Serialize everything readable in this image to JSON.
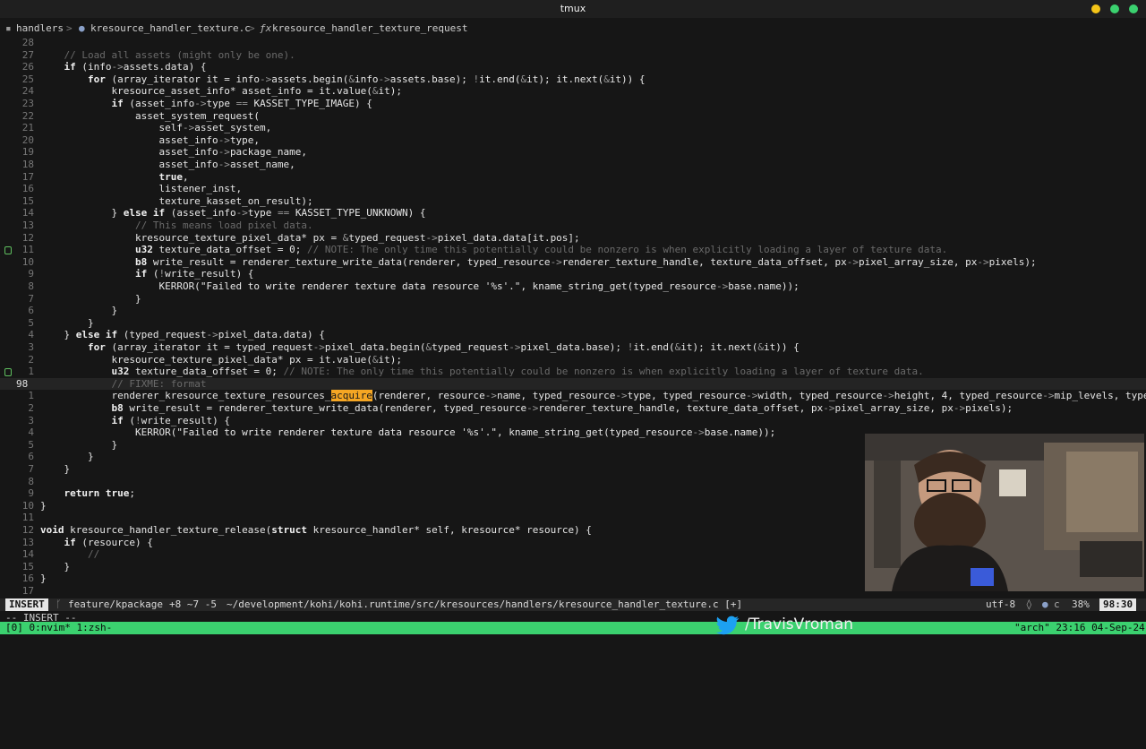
{
  "titlebar": {
    "title": "tmux",
    "buttons": [
      "#f5c518",
      "#3bd16f",
      "#3bd16f"
    ]
  },
  "winbar": {
    "seg1": "handlers",
    "sep1": ">",
    "seg2": "kresource_handler_texture.c",
    "sep2": ">",
    "seg3": "kresource_handler_texture_request"
  },
  "editor": {
    "lines": [
      {
        "ln": "28",
        "t": ""
      },
      {
        "ln": "27",
        "t": "    // Load all assets (might only be one)."
      },
      {
        "ln": "26",
        "t": "    if (info->assets.data) {"
      },
      {
        "ln": "25",
        "t": "        for (array_iterator it = info->assets.begin(&info->assets.base); !it.end(&it); it.next(&it)) {"
      },
      {
        "ln": "24",
        "t": "            kresource_asset_info* asset_info = it.value(&it);"
      },
      {
        "ln": "23",
        "t": "            if (asset_info->type == KASSET_TYPE_IMAGE) {"
      },
      {
        "ln": "22",
        "t": "                asset_system_request("
      },
      {
        "ln": "21",
        "t": "                    self->asset_system,"
      },
      {
        "ln": "20",
        "t": "                    asset_info->type,"
      },
      {
        "ln": "19",
        "t": "                    asset_info->package_name,"
      },
      {
        "ln": "18",
        "t": "                    asset_info->asset_name,"
      },
      {
        "ln": "17",
        "t": "                    true,"
      },
      {
        "ln": "16",
        "t": "                    listener_inst,"
      },
      {
        "ln": "15",
        "t": "                    texture_kasset_on_result);"
      },
      {
        "ln": "14",
        "t": "            } else if (asset_info->type == KASSET_TYPE_UNKNOWN) {"
      },
      {
        "ln": "13",
        "t": "                // This means load pixel data."
      },
      {
        "ln": "12",
        "t": "                kresource_texture_pixel_data* px = &typed_request->pixel_data.data[it.pos];"
      },
      {
        "ln": "11",
        "t": "                u32 texture_data_offset = 0; // NOTE: The only time this potentially could be nonzero is when explicitly loading a layer of texture data.",
        "g": true
      },
      {
        "ln": "10",
        "t": "                b8 write_result = renderer_texture_write_data(renderer, typed_resource->renderer_texture_handle, texture_data_offset, px->pixel_array_size, px->pixels);"
      },
      {
        "ln": "9",
        "t": "                if (!write_result) {"
      },
      {
        "ln": "8",
        "t": "                    KERROR(\"Failed to write renderer texture data resource '%s'.\", kname_string_get(typed_resource->base.name));"
      },
      {
        "ln": "7",
        "t": "                }"
      },
      {
        "ln": "6",
        "t": "            }"
      },
      {
        "ln": "5",
        "t": "        }"
      },
      {
        "ln": "4",
        "t": "    } else if (typed_request->pixel_data.data) {"
      },
      {
        "ln": "3",
        "t": "        for (array_iterator it = typed_request->pixel_data.begin(&typed_request->pixel_data.base); !it.end(&it); it.next(&it)) {"
      },
      {
        "ln": "2",
        "t": "            kresource_texture_pixel_data* px = it.value(&it);"
      },
      {
        "ln": "1",
        "t": "            u32 texture_data_offset = 0; // NOTE: The only time this potentially could be nonzero is when explicitly loading a layer of texture data.",
        "g": true
      },
      {
        "ln": "98",
        "t": "            // FIXME: format ",
        "cur": true
      },
      {
        "ln": "1",
        "t": "            renderer_kresource_texture_resources_acquire(renderer, resource->name, typed_resource->type, typed_resource->width, typed_resource->height, 4, typed_resource->mip_levels, typed_resou"
      },
      {
        "ln": "2",
        "t": "            b8 write_result = renderer_texture_write_data(renderer, typed_resource->renderer_texture_handle, texture_data_offset, px->pixel_array_size, px->pixels);"
      },
      {
        "ln": "3",
        "t": "            if (!write_result) {"
      },
      {
        "ln": "4",
        "t": "                KERROR(\"Failed to write renderer texture data resource '%s'.\", kname_string_get(typed_resource->base.name));"
      },
      {
        "ln": "5",
        "t": "            }"
      },
      {
        "ln": "6",
        "t": "        }"
      },
      {
        "ln": "7",
        "t": "    }"
      },
      {
        "ln": "8",
        "t": ""
      },
      {
        "ln": "9",
        "t": "    return true;"
      },
      {
        "ln": "10",
        "t": "}"
      },
      {
        "ln": "11",
        "t": ""
      },
      {
        "ln": "12",
        "t": "void kresource_handler_texture_release(struct kresource_handler* self, kresource* resource) {"
      },
      {
        "ln": "13",
        "t": "    if (resource) {"
      },
      {
        "ln": "14",
        "t": "        //"
      },
      {
        "ln": "15",
        "t": "    }"
      },
      {
        "ln": "16",
        "t": "}"
      },
      {
        "ln": "17",
        "t": ""
      }
    ],
    "highlight_word": "acquire"
  },
  "statusline": {
    "mode": "INSERT",
    "branch": "feature/kpackage",
    "diff": "+8 ~7 -5",
    "path": "~/development/kohi/kohi.runtime/src/kresources/handlers/kresource_handler_texture.c [+]",
    "encoding": "utf-8",
    "percent": "38%",
    "position": "98:30"
  },
  "cmdline": "-- INSERT --",
  "tmux": {
    "session": "[0] 0:nvim* 1:zsh-",
    "right": "\"arch\" 23:16 04-Sep-24"
  },
  "overlay": {
    "twitter_handle": "/TravisVroman"
  }
}
